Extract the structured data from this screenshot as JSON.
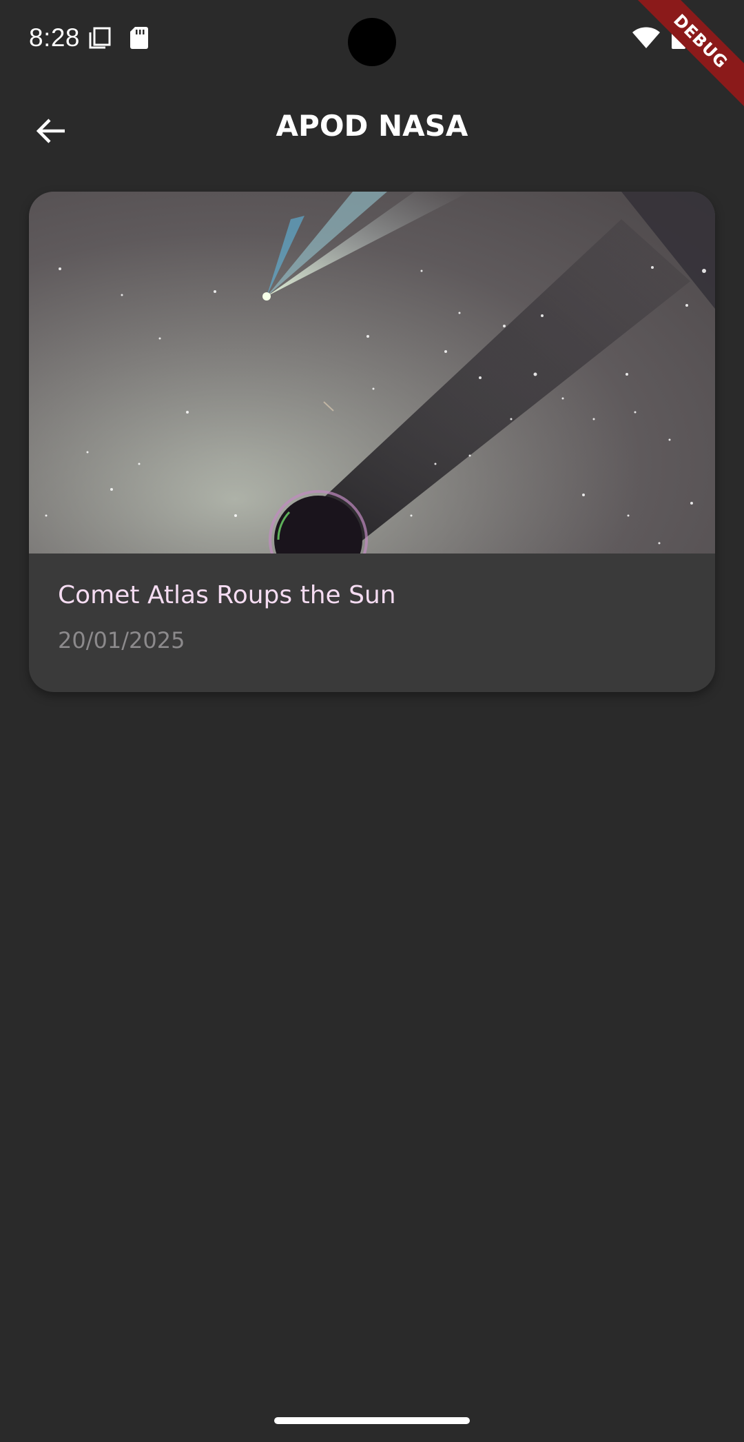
{
  "status_bar": {
    "time": "8:28",
    "icons": [
      "copy-icon",
      "sd-card-icon",
      "wifi-icon",
      "battery-icon"
    ],
    "debug_label": "DEBUG"
  },
  "app_bar": {
    "title": "APOD NASA",
    "back_icon": "arrow-back-icon"
  },
  "apod_list": [
    {
      "title": "Comet Atlas Roups the Sun",
      "date": "20/01/2025",
      "image": "comet-photo"
    }
  ],
  "colors": {
    "background": "#2a2a2a",
    "card": "#3a3a3a",
    "title_text": "#f5dcf2",
    "date_text": "#8c8a8c",
    "debug_ribbon": "#8b1a1a"
  }
}
